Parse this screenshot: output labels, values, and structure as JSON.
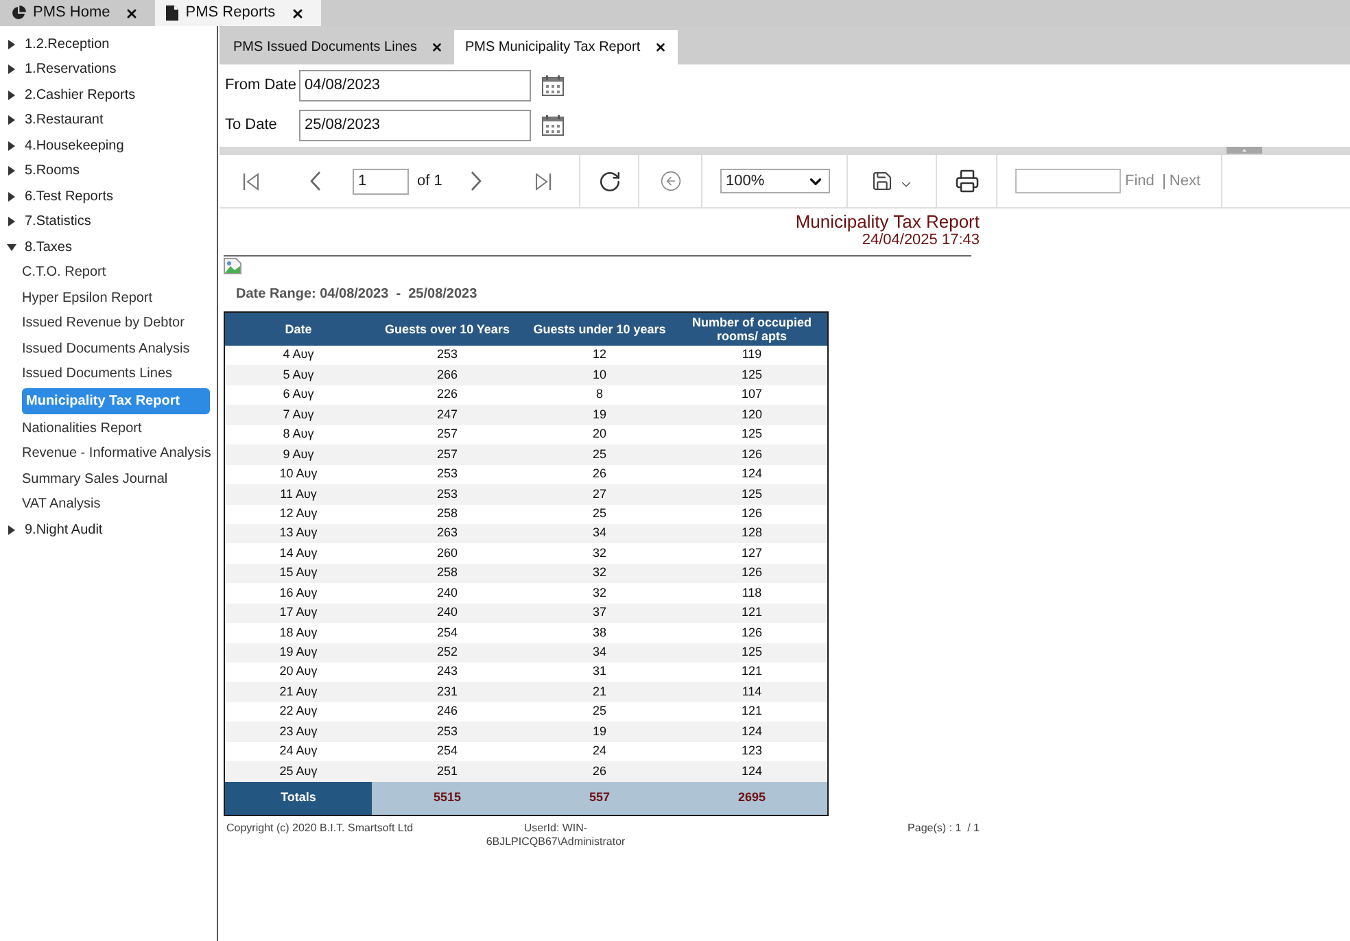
{
  "app_tabs": [
    {
      "label": "PMS Home",
      "selected": false
    },
    {
      "label": "PMS Reports",
      "selected": true
    }
  ],
  "sidebar": {
    "items": [
      {
        "label": "1.2.Reception",
        "expanded": false
      },
      {
        "label": "1.Reservations",
        "expanded": false
      },
      {
        "label": "2.Cashier Reports",
        "expanded": false
      },
      {
        "label": "3.Restaurant",
        "expanded": false
      },
      {
        "label": "4.Housekeeping",
        "expanded": false
      },
      {
        "label": "5.Rooms",
        "expanded": false
      },
      {
        "label": "6.Test Reports",
        "expanded": false
      },
      {
        "label": "7.Statistics",
        "expanded": false
      },
      {
        "label": "8.Taxes",
        "expanded": true,
        "children": [
          {
            "label": "C.T.O. Report",
            "selected": false
          },
          {
            "label": "Hyper Epsilon Report",
            "selected": false
          },
          {
            "label": "Issued Revenue by Debtor",
            "selected": false
          },
          {
            "label": "Issued Documents Analysis",
            "selected": false
          },
          {
            "label": "Issued Documents Lines",
            "selected": false
          },
          {
            "label": "Municipality Tax Report",
            "selected": true
          },
          {
            "label": "Nationalities Report",
            "selected": false
          },
          {
            "label": "Revenue - Informative Analysis",
            "selected": false
          },
          {
            "label": "Summary Sales Journal",
            "selected": false
          },
          {
            "label": "VAT Analysis",
            "selected": false
          }
        ]
      },
      {
        "label": "9.Night Audit",
        "expanded": false
      }
    ]
  },
  "report_tabs": [
    {
      "label": "PMS Issued Documents Lines",
      "selected": false
    },
    {
      "label": "PMS Municipality Tax Report",
      "selected": true
    }
  ],
  "parameters": [
    {
      "label": "From Date",
      "value": "04/08/2023"
    },
    {
      "label": "To Date",
      "value": "25/08/2023"
    }
  ],
  "toolbar": {
    "page": "1",
    "page_count": "of 1",
    "zoom": "100%",
    "find_label": "Find",
    "next_label": "Next"
  },
  "report": {
    "title": "Municipality Tax Report",
    "timestamp": "24/04/2025 17:43",
    "date_range": "Date Range: 04/08/2023  -  25/08/2023"
  },
  "table": {
    "columns": [
      "Date",
      "Guests over 10 Years",
      "Guests under 10 years",
      "Number of occupied rooms/ apts"
    ],
    "rows": [
      [
        "4 Αυγ",
        "253",
        "12",
        "119"
      ],
      [
        "5 Αυγ",
        "266",
        "10",
        "125"
      ],
      [
        "6 Αυγ",
        "226",
        "8",
        "107"
      ],
      [
        "7 Αυγ",
        "247",
        "19",
        "120"
      ],
      [
        "8 Αυγ",
        "257",
        "20",
        "125"
      ],
      [
        "9 Αυγ",
        "257",
        "25",
        "126"
      ],
      [
        "10 Αυγ",
        "253",
        "26",
        "124"
      ],
      [
        "11 Αυγ",
        "253",
        "27",
        "125"
      ],
      [
        "12 Αυγ",
        "258",
        "25",
        "126"
      ],
      [
        "13 Αυγ",
        "263",
        "34",
        "128"
      ],
      [
        "14 Αυγ",
        "260",
        "32",
        "127"
      ],
      [
        "15 Αυγ",
        "258",
        "32",
        "126"
      ],
      [
        "16 Αυγ",
        "240",
        "32",
        "118"
      ],
      [
        "17 Αυγ",
        "240",
        "37",
        "121"
      ],
      [
        "18 Αυγ",
        "254",
        "38",
        "126"
      ],
      [
        "19 Αυγ",
        "252",
        "34",
        "125"
      ],
      [
        "20 Αυγ",
        "243",
        "31",
        "121"
      ],
      [
        "21 Αυγ",
        "231",
        "21",
        "114"
      ],
      [
        "22 Αυγ",
        "246",
        "25",
        "121"
      ],
      [
        "23 Αυγ",
        "253",
        "19",
        "124"
      ],
      [
        "24 Αυγ",
        "254",
        "24",
        "123"
      ],
      [
        "25 Αυγ",
        "251",
        "26",
        "124"
      ]
    ],
    "totals": {
      "label": "Totals",
      "values": [
        "5515",
        "557",
        "2695"
      ]
    }
  },
  "footer": {
    "copyright": "Copyright (c) 2020 B.I.T. Smartsoft Ltd",
    "user": "UserId: WIN-6BJLPICQB67\\Administrator",
    "pages": "Page(s) : 1  / 1"
  }
}
